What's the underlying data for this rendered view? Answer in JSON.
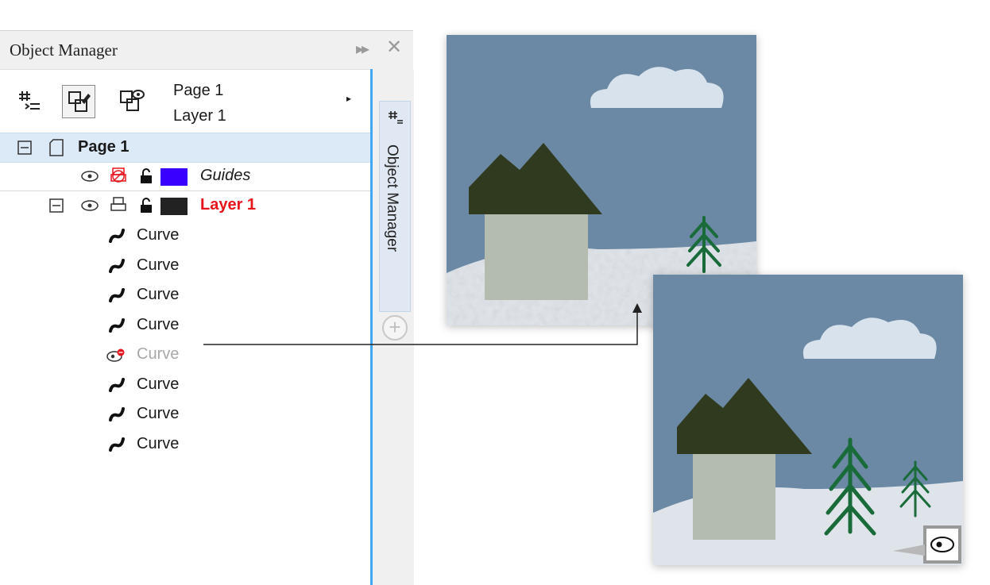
{
  "panel": {
    "title": "Object Manager",
    "toolbar": {
      "page_label": "Page 1",
      "layer_label": "Layer 1"
    },
    "tree": {
      "page": {
        "label": "Page 1"
      },
      "guides": {
        "label": "Guides",
        "color": "#3a00ff"
      },
      "layer": {
        "label": "Layer 1",
        "color": "#222222"
      },
      "curves": [
        {
          "label": "Curve",
          "visible": true
        },
        {
          "label": "Curve",
          "visible": true
        },
        {
          "label": "Curve",
          "visible": true
        },
        {
          "label": "Curve",
          "visible": true
        },
        {
          "label": "Curve",
          "visible": false
        },
        {
          "label": "Curve",
          "visible": true
        },
        {
          "label": "Curve",
          "visible": true
        },
        {
          "label": "Curve",
          "visible": true
        }
      ]
    },
    "docker_tab": "Object Manager"
  },
  "colors": {
    "sky": "#6b89a4",
    "roof": "#2f3a1e",
    "wall": "#b4bcb0",
    "tree": "#1a6b3a",
    "snow": "#dfe4ea",
    "accent": "#3fa9f5",
    "hidden_badge": "#e8131b"
  }
}
